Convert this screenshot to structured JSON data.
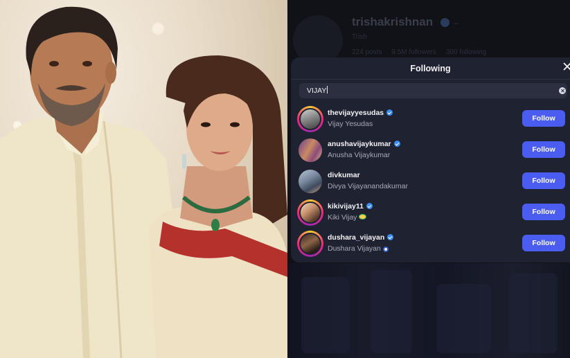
{
  "profile": {
    "username": "trishakrishnan",
    "display_name": "Trish",
    "stats": [
      "224 posts",
      "9.5M followers",
      "300 following"
    ]
  },
  "modal": {
    "title": "Following",
    "search_value": "VIJAY",
    "users": [
      {
        "username": "thevijayyesudas",
        "full_name": "Vijay Yesudas",
        "verified": true,
        "ring": true
      },
      {
        "username": "anushavijaykumar",
        "full_name": "Anusha Vijaykumar",
        "verified": true,
        "ring": false
      },
      {
        "username": "divkumar",
        "full_name": "Divya Vijayanandakumar",
        "verified": false,
        "ring": false
      },
      {
        "username": "kikivijay11",
        "full_name": "Kiki Vijay",
        "verified": true,
        "ring": true,
        "emoji": "gold-circle-icon"
      },
      {
        "username": "dushara_vijayan",
        "full_name": "Dushara Vijayan",
        "verified": true,
        "ring": true,
        "emoji": "blue-ring-icon"
      }
    ],
    "follow_label": "Follow"
  },
  "colors": {
    "follow_button": "#4a5df0",
    "verified_badge": "#3b8ef5",
    "modal_bg": "#1f2230"
  }
}
